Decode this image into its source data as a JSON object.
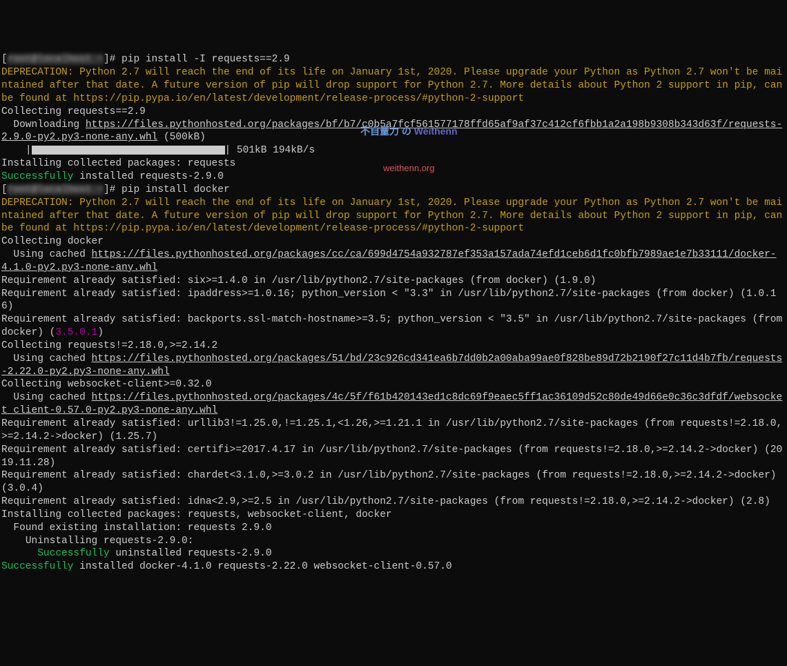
{
  "prompt_prefix": "[",
  "prompt_host1": "root@localhost ~",
  "prompt_host2": "root@localhost ~",
  "prompt_suffix": "]# ",
  "cmd1": "pip install -I requests==2.9",
  "cmd2": "pip install docker",
  "deprecation": "DEPRECATION: Python 2.7 will reach the end of its life on January 1st, 2020. Please upgrade your Python as Python 2.7 won't be maintained after that date. A future version of pip will drop support for Python 2.7. More details about Python 2 support in pip, can be found at https://pip.pypa.io/en/latest/development/release-process/#python-2-support",
  "collecting_requests": "Collecting requests==2.9",
  "downloading": "  Downloading ",
  "url_requests29": "https://files.pythonhosted.org/packages/bf/b7/c0b5a7fcf561577178ffd65af9af37c412cf6fbb1a2a198b9308b343d63f/requests-2.9.0-py2.py3-none-any.whl",
  "size_500kb": " (500kB)",
  "progress_prefix": "    |",
  "progress_suffix": "| 501kB 194kB/s",
  "installing_requests": "Installing collected packages: requests",
  "successfully": "Successfully",
  "installed_requests290": " installed requests-2.9.0",
  "collecting_docker": "Collecting docker",
  "using_cached": "  Using cached ",
  "url_docker": "https://files.pythonhosted.org/packages/cc/ca/699d4754a932787ef353a157ada74efd1ceb6d1fc0bfb7989ae1e7b33111/docker-4.1.0-py2.py3-none-any.whl",
  "req_six": "Requirement already satisfied: six>=1.4.0 in /usr/lib/python2.7/site-packages (from docker) (1.9.0)",
  "req_ipaddress": "Requirement already satisfied: ipaddress>=1.0.16; python_version < \"3.3\" in /usr/lib/python2.7/site-packages (from docker) (1.0.16)",
  "req_backports_pre": "Requirement already satisfied: backports.ssl-match-hostname>=3.5; python_version < \"3.5\" in /usr/lib/python2.7/site-packages (from docker) (",
  "req_backports_ver": "3.5.0.1",
  "req_backports_post": ")",
  "collecting_requests2": "Collecting requests!=2.18.0,>=2.14.2",
  "url_requests2220": "https://files.pythonhosted.org/packages/51/bd/23c926cd341ea6b7dd0b2a00aba99ae0f828be89d72b2190f27c11d4b7fb/requests-2.22.0-py2.py3-none-any.whl",
  "collecting_websocket": "Collecting websocket-client>=0.32.0",
  "url_websocket": "https://files.pythonhosted.org/packages/4c/5f/f61b420143ed1c8dc69f9eaec5ff1ac36109d52c80de49d66e0c36c3dfdf/websocket_client-0.57.0-py2.py3-none-any.whl",
  "req_urllib3": "Requirement already satisfied: urllib3!=1.25.0,!=1.25.1,<1.26,>=1.21.1 in /usr/lib/python2.7/site-packages (from requests!=2.18.0,>=2.14.2->docker) (1.25.7)",
  "req_certifi": "Requirement already satisfied: certifi>=2017.4.17 in /usr/lib/python2.7/site-packages (from requests!=2.18.0,>=2.14.2->docker) (2019.11.28)",
  "req_chardet": "Requirement already satisfied: chardet<3.1.0,>=3.0.2 in /usr/lib/python2.7/site-packages (from requests!=2.18.0,>=2.14.2->docker) (3.0.4)",
  "req_idna": "Requirement already satisfied: idna<2.9,>=2.5 in /usr/lib/python2.7/site-packages (from requests!=2.18.0,>=2.14.2->docker) (2.8)",
  "installing_docker": "Installing collected packages: requests, websocket-client, docker",
  "found_existing": "  Found existing installation: requests 2.9.0",
  "uninstalling": "    Uninstalling requests-2.9.0:",
  "uninst_pad": "      ",
  "uninstalled_requests": " uninstalled requests-2.9.0",
  "installed_docker": " installed docker-4.1.0 requests-2.22.0 websocket-client-0.57.0",
  "watermark_cn": "不自量力 の ",
  "watermark_en": "Weithenn",
  "watermark_url": "weithenn.org"
}
